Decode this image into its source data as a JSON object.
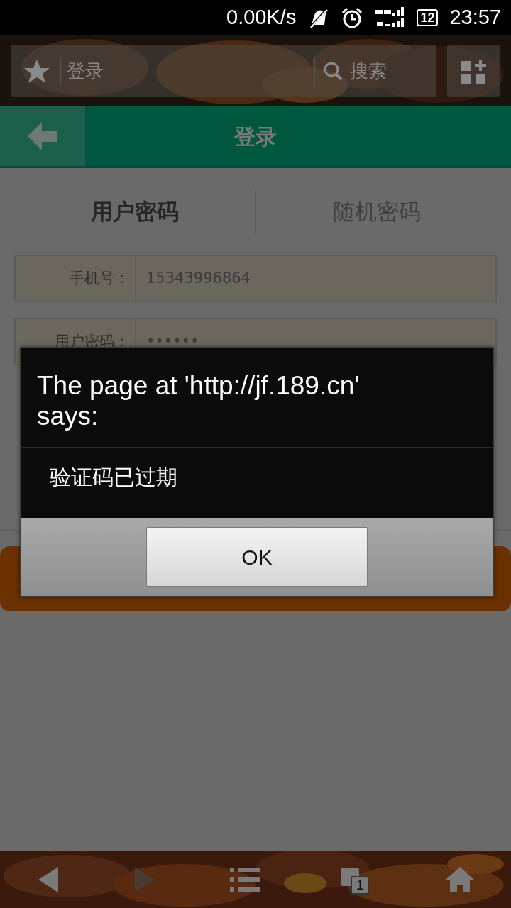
{
  "status_bar": {
    "net_speed": "0.00K/s",
    "battery": "12",
    "time": "23:57"
  },
  "browser_toolbar": {
    "address": "登录",
    "search": "搜索"
  },
  "page_header": {
    "title": "登录"
  },
  "login_tabs": [
    {
      "label": "用户密码",
      "selected": true
    },
    {
      "label": "随机密码",
      "selected": false
    }
  ],
  "form_rows": [
    {
      "label": "手机号：",
      "value": "15343996864"
    },
    {
      "label": "用户密码：",
      "value": "••••••"
    }
  ],
  "dialog": {
    "title": "The page at 'http://jf.189.cn' says:",
    "message": "验证码已过期",
    "button": "OK"
  },
  "bottom_bar": {
    "items": [
      {
        "kind": "back",
        "disabled": false
      },
      {
        "kind": "forward",
        "disabled": true
      },
      {
        "kind": "menu",
        "disabled": false
      },
      {
        "kind": "tabs",
        "disabled": false,
        "count": "1"
      },
      {
        "kind": "home",
        "disabled": false
      }
    ]
  }
}
